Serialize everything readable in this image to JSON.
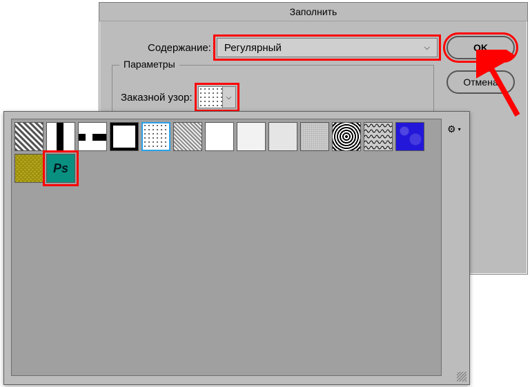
{
  "dialog": {
    "title": "Заполнить",
    "content_label": "Содержание:",
    "content_value": "Регулярный",
    "ok": "OK",
    "cancel": "Отмена",
    "fieldset": {
      "legend": "Параметры",
      "pattern_label": "Заказной узор:"
    }
  },
  "picker": {
    "gear_icon": "⚙",
    "swatches": [
      {
        "name": "diagonal-stripes-1",
        "cls": "p1",
        "selected": false,
        "highlight": false
      },
      {
        "name": "block-black-on-white",
        "cls": "p2",
        "selected": false,
        "highlight": false
      },
      {
        "name": "horizontal-bars",
        "cls": "p3",
        "selected": false,
        "highlight": false
      },
      {
        "name": "square-frame",
        "cls": "p4",
        "selected": false,
        "highlight": false
      },
      {
        "name": "dot-grid",
        "cls": "p5",
        "selected": true,
        "highlight": false
      },
      {
        "name": "diagonal-stripes-2",
        "cls": "p6",
        "selected": false,
        "highlight": false
      },
      {
        "name": "white",
        "cls": "p7",
        "selected": false,
        "highlight": false
      },
      {
        "name": "light-gray-1",
        "cls": "p8",
        "selected": false,
        "highlight": false
      },
      {
        "name": "light-gray-2",
        "cls": "p9",
        "selected": false,
        "highlight": false
      },
      {
        "name": "noise",
        "cls": "p10",
        "selected": false,
        "highlight": false
      },
      {
        "name": "concentric-squares",
        "cls": "p11",
        "selected": false,
        "highlight": false
      },
      {
        "name": "wavy",
        "cls": "p12",
        "selected": false,
        "highlight": false
      },
      {
        "name": "blue-texture",
        "cls": "p13",
        "selected": false,
        "highlight": false
      },
      {
        "name": "yellow-noise",
        "cls": "p14",
        "selected": false,
        "highlight": false
      },
      {
        "name": "ps-logo",
        "cls": "pPS",
        "selected": false,
        "highlight": true,
        "text": "Ps"
      }
    ]
  }
}
